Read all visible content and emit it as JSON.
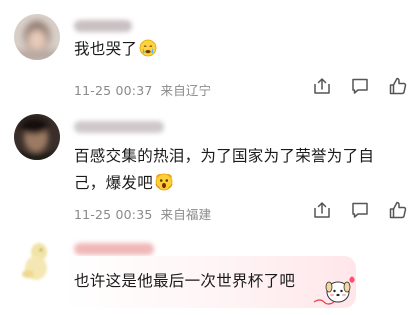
{
  "comments": [
    {
      "text": "我也哭了",
      "emoji_icon": "crying-face-emoji",
      "time": "11-25 00:37",
      "location": "来自辽宁"
    },
    {
      "text_line1": "百感交集的热泪，为了国家为了荣誉为了自",
      "text_line2": "己，爆发吧",
      "emoji_icon": "scream-face-emoji",
      "time": "11-25 00:35",
      "location": "来自福建"
    },
    {
      "text": "也许这是他最后一次世界杯了吧",
      "sticker_icon": "cute-dog-sticker"
    }
  ],
  "actions": [
    "share-icon",
    "comment-icon",
    "like-icon"
  ],
  "colors": {
    "text": "#1a1a1a",
    "meta": "#8a8a8a",
    "icon": "#555555",
    "bubble": "#ffe6ea"
  }
}
